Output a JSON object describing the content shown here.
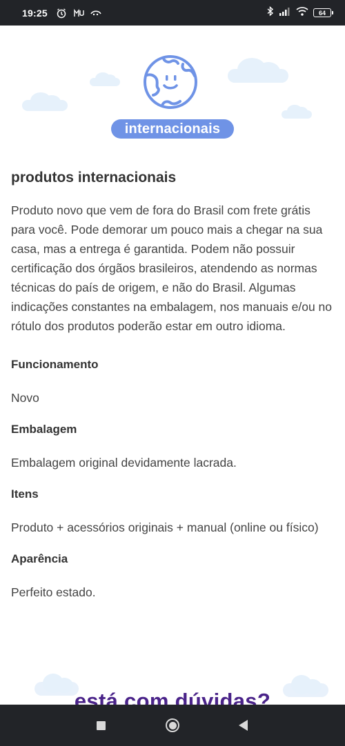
{
  "status_bar": {
    "time": "19:25",
    "battery": "64"
  },
  "hero": {
    "badge": "internacionais"
  },
  "main": {
    "section_title": "produtos internacionais",
    "description": "Produto novo que vem de fora do Brasil com frete grátis para você. Pode demorar um pouco mais a chegar na sua casa, mas a entrega é garantida. Podem não possuir certificação dos órgãos brasileiros, atendendo as normas técnicas do país de origem, e não do Brasil. Algumas indicações constantes na embalagem, nos manuais e/ou no rótulo dos produtos poderão estar em outro idioma.",
    "specs": [
      {
        "label": "Funcionamento",
        "value": "Novo"
      },
      {
        "label": "Embalagem",
        "value": "Embalagem original devidamente lacrada."
      },
      {
        "label": "Itens",
        "value": "Produto + acessórios originais + manual (online ou físico)"
      },
      {
        "label": "Aparência",
        "value": "Perfeito estado."
      }
    ]
  },
  "footer": {
    "heading": "está com dúvidas?"
  },
  "colors": {
    "badge": "#6f93e6",
    "globe": "#6f93e6",
    "heading_purple": "#4a2389",
    "system_bar": "#222428"
  }
}
